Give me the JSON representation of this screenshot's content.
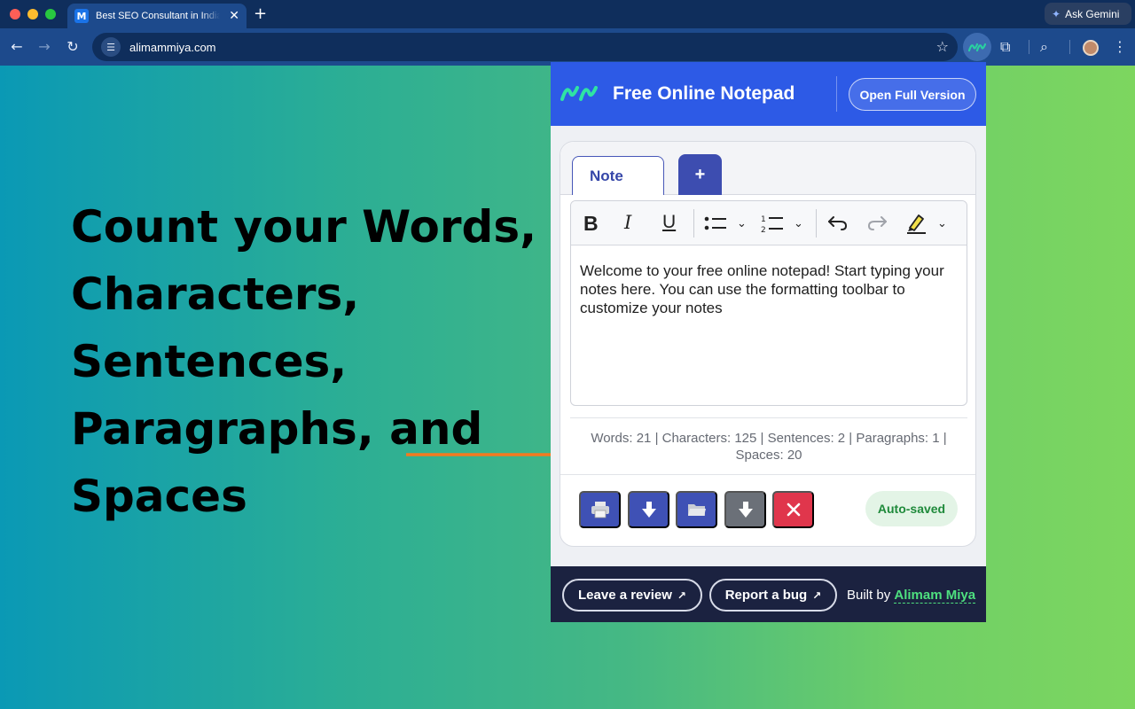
{
  "browser": {
    "tab_title": "Best SEO Consultant in India",
    "tab_close": "✕",
    "new_tab": "+",
    "gemini_label": "Ask Gemini",
    "url": "alimammiya.com",
    "icons": [
      "back-icon",
      "forward-icon",
      "reload-icon",
      "site-info-icon",
      "bookmark-star-icon",
      "extensions-puzzle-icon",
      "tab-search-icon",
      "profile-avatar",
      "menu-icon"
    ]
  },
  "headline": {
    "lines": [
      "Count your Words,",
      "Characters,",
      "Sentences,",
      "Paragraphs, and",
      "Spaces"
    ]
  },
  "popup": {
    "title": "Free Online Notepad",
    "open_full": "Open Full Version",
    "tab_label": "Note",
    "add_tab": "+",
    "toolbar": {
      "bold": "B",
      "italic": "I",
      "underline": "U"
    },
    "editor_text": "Welcome to your free online notepad! Start typing your notes here. You can use the formatting toolbar to customize your notes",
    "stats": "Words: 21 | Characters: 125 | Sentences: 2 | Paragraphs: 1 | Spaces: 20",
    "actions": [
      "print-icon",
      "download-icon",
      "folder-icon",
      "save-download-icon",
      "clear-icon"
    ],
    "autosaved": "Auto-saved",
    "footer": {
      "review": "Leave a review",
      "bug": "Report a bug",
      "built_by": "Built by",
      "author": "Alimam Miya"
    }
  },
  "colors": {
    "header_blue": "#2d5ae6",
    "primary_button": "#3f51b5",
    "danger": "#e0364c",
    "footer_bg": "#1b2240",
    "author_green": "#4ee07f",
    "arrow_orange": "#f47a1f"
  }
}
